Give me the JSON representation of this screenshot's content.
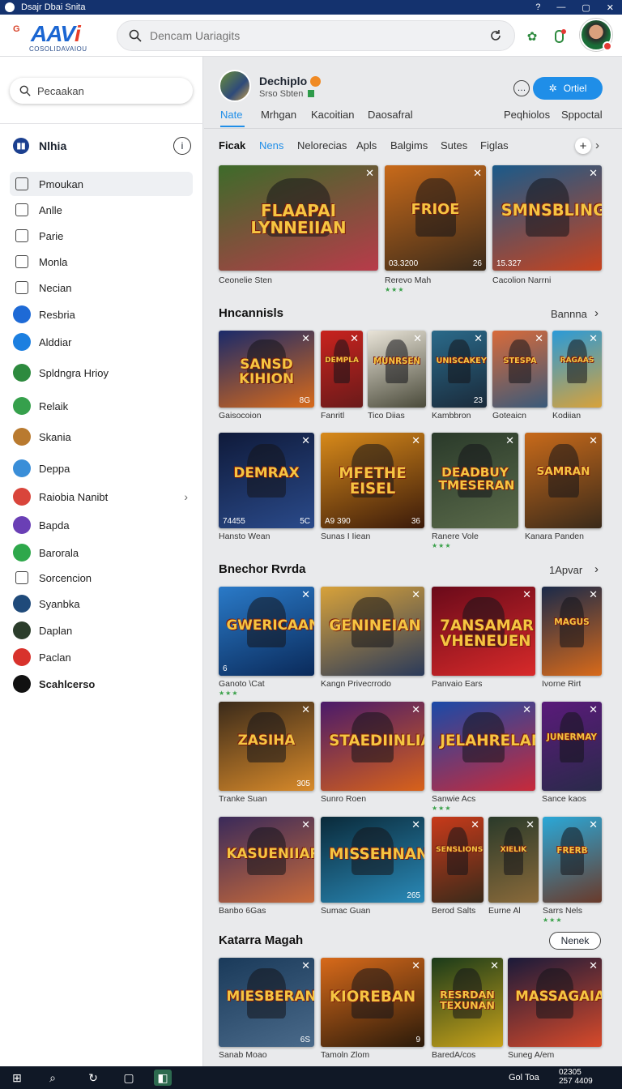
{
  "titlebar": {
    "title": "Dsajr Dbai Snita",
    "buttons": [
      "?",
      "—",
      "▢",
      "✕"
    ]
  },
  "logo": {
    "text_main": "AAV",
    "text_accent": "i",
    "tagline": "COSOLIDAVAIOU",
    "g": "G"
  },
  "search": {
    "placeholder": "Dencam Uariagits",
    "value": ""
  },
  "sidebar": {
    "search_label": "Pecaakan",
    "header": {
      "label": "Nlhia",
      "info": "i"
    },
    "items": [
      {
        "label": "Pmoukan",
        "icon": "home-icon",
        "active": true
      },
      {
        "label": "Anlle",
        "icon": "list-icon"
      },
      {
        "label": "Parie",
        "icon": "grid-icon"
      },
      {
        "label": "Monla",
        "icon": "people-icon"
      },
      {
        "label": "Necian",
        "icon": "window-icon"
      },
      {
        "label": "Resbria",
        "icon": "avatar-blue",
        "color": "#1e6ad6"
      },
      {
        "label": "Alddiar",
        "icon": "avatar-blue",
        "color": "#1c7fe0"
      },
      {
        "label": "Spldngra Hrioy",
        "icon": "avatar-green",
        "color": "#2d8a3e"
      },
      {
        "label": "Relaik",
        "icon": "avatar-green",
        "color": "#36a04c"
      },
      {
        "label": "Skania",
        "icon": "game-avatar",
        "color": "#b97a2f"
      },
      {
        "label": "Deppa",
        "icon": "avatar-blue",
        "color": "#3a8ed8"
      },
      {
        "label": "Raiobia Nanibt",
        "icon": "avatar-red",
        "color": "#d9453b",
        "chevron": "›"
      },
      {
        "label": "Bapda",
        "icon": "avatar-purple",
        "color": "#6a3fb5"
      },
      {
        "label": "Barorala",
        "icon": "avatar-green",
        "color": "#2ea84b"
      },
      {
        "label": "Sorcencion",
        "icon": "person-outline-icon"
      },
      {
        "label": "Syanbka",
        "icon": "avatar-dark",
        "color": "#1f4a7a"
      },
      {
        "label": "Daplan",
        "icon": "avatar-dark",
        "color": "#2b3d2b"
      },
      {
        "label": "Paclan",
        "icon": "play-avatar",
        "color": "#d8322c"
      },
      {
        "label": "Scahlcerso",
        "icon": "avatar-black",
        "color": "#111111",
        "bold": true
      }
    ]
  },
  "channel": {
    "name": "Dechiplo",
    "subtitle": "Srso Sbten",
    "more": "…",
    "button": "Ortiel",
    "tabs": [
      "Nate",
      "Mrhgan",
      "Kacoitian",
      "Daosafral",
      "Peqhiolos",
      "Sppoctal"
    ]
  },
  "categories": [
    "Ficak",
    "Nens",
    "Nelorecias",
    "Apls",
    "Balgims",
    "Sutes",
    "Figlas"
  ],
  "sections": {
    "s1": {
      "title": "Hncannisls",
      "more": "Bannna"
    },
    "s2": {
      "title": "Bnechor Rvrda",
      "more": "1Apvar"
    },
    "s3": {
      "title": "Katarra Magah",
      "button": "Nenek"
    }
  },
  "featured": [
    {
      "art": "FLAAPAI LYNNEIIAN",
      "caption": "Ceonelie Sten",
      "corner": "",
      "bl": "",
      "c1": "#3d6b2a",
      "c2": "#b83b4a"
    },
    {
      "art": "FRIOE",
      "caption": "Rerevo Mah",
      "corner": "26",
      "bl": "03.3200",
      "c1": "#c86a1a",
      "c2": "#3a2a1a",
      "rating": "★★★"
    },
    {
      "art": "SMNSBLING",
      "caption": "Cacolion Narrni",
      "corner": "",
      "bl": "15.327",
      "c1": "#1a5a8a",
      "c2": "#c8431e"
    }
  ],
  "row2": [
    {
      "art": "SANSD KIHION",
      "caption": "Gaisocoion",
      "corner": "8G",
      "c1": "#1a2a6a",
      "c2": "#d86a1a"
    },
    {
      "art": "DEMPLA",
      "caption": "Fanritl",
      "corner": "",
      "c1": "#c8231e",
      "c2": "#6a1a1a"
    },
    {
      "art": "MUNRSEN",
      "caption": "Tico Diias",
      "corner": "",
      "c1": "#e9e4d8",
      "c2": "#4a4a3a"
    },
    {
      "art": "UNISCAKEY",
      "caption": "Kambbron",
      "corner": "23",
      "c1": "#2a6a8a",
      "c2": "#1a2a3a"
    },
    {
      "art": "STESPA",
      "caption": "Goteaicn",
      "corner": "",
      "c1": "#d86a3a",
      "c2": "#3a5a7a"
    },
    {
      "art": "RAGAAS",
      "caption": "Kodiian",
      "corner": "",
      "c1": "#2a9ad8",
      "c2": "#d8a23a"
    }
  ],
  "row3": [
    {
      "art": "DEMRAX",
      "caption": "Hansto Wean",
      "corner": "5C",
      "bl": "74455",
      "c1": "#0f1a3a",
      "c2": "#2a4a8a"
    },
    {
      "art": "MFETHE EISEL",
      "caption": "Sunas I Iiean",
      "corner": "36",
      "bl": "A9 390",
      "c1": "#d88a1a",
      "c2": "#3a1a0a"
    },
    {
      "art": "DEADBUY TMESERAN",
      "caption": "Ranere Vole",
      "corner": "",
      "c1": "#2a3a2a",
      "c2": "#5a6a4a",
      "rating": "★★★"
    },
    {
      "art": "SAMRAN",
      "caption": "Kanara Panden",
      "corner": "",
      "c1": "#c86a1a",
      "c2": "#3a2a1a"
    }
  ],
  "row4": [
    {
      "art": "GWERICAANS",
      "caption": "Ganoto \\Cat",
      "corner": "",
      "bl": "6",
      "c1": "#2a7ac8",
      "c2": "#0a2a5a",
      "rating": "★★★"
    },
    {
      "art": "GENINEIAN",
      "caption": "Kangn Privecrrodo",
      "corner": "",
      "c1": "#d8a23a",
      "c2": "#2a3a5a"
    },
    {
      "art": "7ANSAMAR VHENEUEN",
      "caption": "Panvaio Ears",
      "corner": "",
      "c1": "#6a0a1a",
      "c2": "#d82a2a"
    },
    {
      "art": "MAGUS",
      "caption": "Ivorne Rirt",
      "corner": "",
      "c1": "#1a2a4a",
      "c2": "#d86a1a"
    }
  ],
  "row5": [
    {
      "art": "ZASIHA",
      "caption": "Tranke Suan",
      "corner": "305",
      "c1": "#3a2a1a",
      "c2": "#d88a2a"
    },
    {
      "art": "STAEDIINLIANE",
      "caption": "Sunro Roen",
      "corner": "",
      "c1": "#4a1a6a",
      "c2": "#d8621a"
    },
    {
      "art": "JELAHRELAN",
      "caption": "Sanwie Acs",
      "corner": "",
      "c1": "#1a4aa8",
      "c2": "#c82a3a",
      "rating": "★★★"
    },
    {
      "art": "JUNERMAY",
      "caption": "Sance kaos",
      "corner": "",
      "c1": "#5a1a7a",
      "c2": "#2a2a4a"
    }
  ],
  "row6": [
    {
      "art": "KASUENIIAR",
      "caption": "Banbo 6Gas",
      "corner": "",
      "c1": "#3a2a5a",
      "c2": "#c86a3a"
    },
    {
      "art": "MISSEHNAN",
      "caption": "Sumac Guan",
      "corner": "265",
      "c1": "#0a2a3a",
      "c2": "#2a8ab8"
    },
    {
      "art": "SENSLIONS",
      "caption": "Berod Salts",
      "corner": "",
      "c1": "#c83a1a",
      "c2": "#3a2a1a"
    },
    {
      "art": "XIELIK",
      "caption": "Eurne Al",
      "corner": "",
      "c1": "#2a3a2a",
      "c2": "#8a6a3a"
    },
    {
      "art": "FRERB",
      "caption": "Sarrs Nels",
      "corner": "",
      "c1": "#2aa8d8",
      "c2": "#6a3a2a",
      "rating": "★★★"
    }
  ],
  "row7": [
    {
      "art": "MIESBERAN",
      "caption": "Sanab Moao",
      "corner": "6S",
      "c1": "#1a3a5a",
      "c2": "#4a6a8a"
    },
    {
      "art": "KIOREBAN",
      "caption": "Tamoln Zlom",
      "corner": "9",
      "c1": "#d86a1a",
      "c2": "#2a1a0a"
    },
    {
      "art": "RESRDAN TEXUNAN",
      "caption": "BaredA/cos",
      "corner": "",
      "c1": "#1a3a1a",
      "c2": "#c8a21a"
    },
    {
      "art": "MASSAGAIAA",
      "caption": "Suneg A/em",
      "corner": "",
      "c1": "#1a1a3a",
      "c2": "#d84a2a"
    }
  ],
  "taskbar": {
    "label": "Gol Toa",
    "time": "02305",
    "date": "257 4409"
  }
}
